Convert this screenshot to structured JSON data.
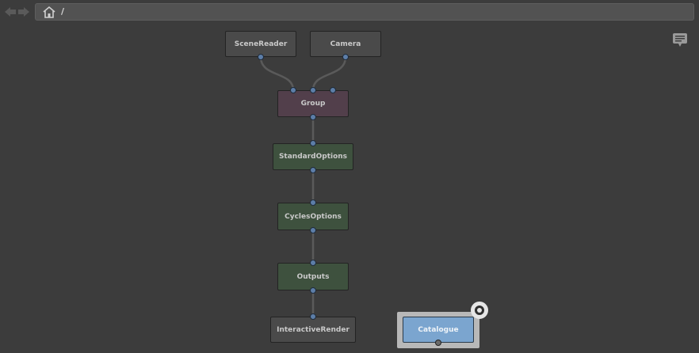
{
  "toolbar": {
    "back_icon": "arrow-left-icon",
    "forward_icon": "arrow-right-icon",
    "home_icon": "home-icon",
    "path": "/"
  },
  "notes_icon": "speech-bubble-icon",
  "graph": {
    "nodes": {
      "scene_reader": "SceneReader",
      "camera": "Camera",
      "group": "Group",
      "standard_options": "StandardOptions",
      "cycles_options": "CyclesOptions",
      "outputs": "Outputs",
      "interactive_render": "InteractiveRender",
      "catalogue": "Catalogue"
    },
    "colors": {
      "grey_node": "#4a4a4a",
      "group_node": "#523f4b",
      "options_node": "#3e513e",
      "selected_node": "#7ba5cf",
      "wire": "#5a5a5a",
      "plug": "#5d7ea8"
    }
  }
}
